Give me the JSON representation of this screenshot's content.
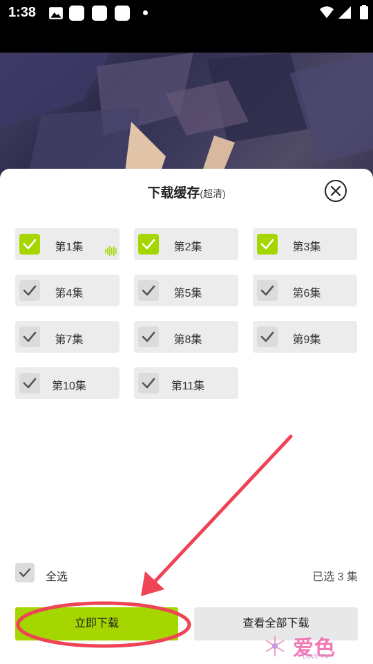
{
  "status_bar": {
    "time": "1:38"
  },
  "sheet": {
    "title": "下载缓存",
    "quality": "(超清)",
    "episodes": [
      {
        "label": "第1集",
        "checked": true,
        "playing": true
      },
      {
        "label": "第2集",
        "checked": true
      },
      {
        "label": "第3集",
        "checked": true
      },
      {
        "label": "第4集",
        "checked": false
      },
      {
        "label": "第5集",
        "checked": false
      },
      {
        "label": "第6集",
        "checked": false
      },
      {
        "label": "第7集",
        "checked": false
      },
      {
        "label": "第8集",
        "checked": false
      },
      {
        "label": "第9集",
        "checked": false
      },
      {
        "label": "第10集",
        "checked": false
      },
      {
        "label": "第11集",
        "checked": false
      }
    ],
    "select_all_label": "全选",
    "selected_count": "已选 3 集",
    "download_button": "立即下载",
    "view_all_button": "查看全部下载"
  },
  "watermark": {
    "brand": "爱色",
    "sub": "LOVE TV"
  },
  "colors": {
    "accent": "#a6d600",
    "annotation": "#ee4455"
  },
  "icons": {
    "status": [
      "image-icon",
      "wifi-icon",
      "signal-icon",
      "battery-icon"
    ],
    "close": "close-icon",
    "check": "check-icon",
    "playing": "sound-wave-icon"
  }
}
